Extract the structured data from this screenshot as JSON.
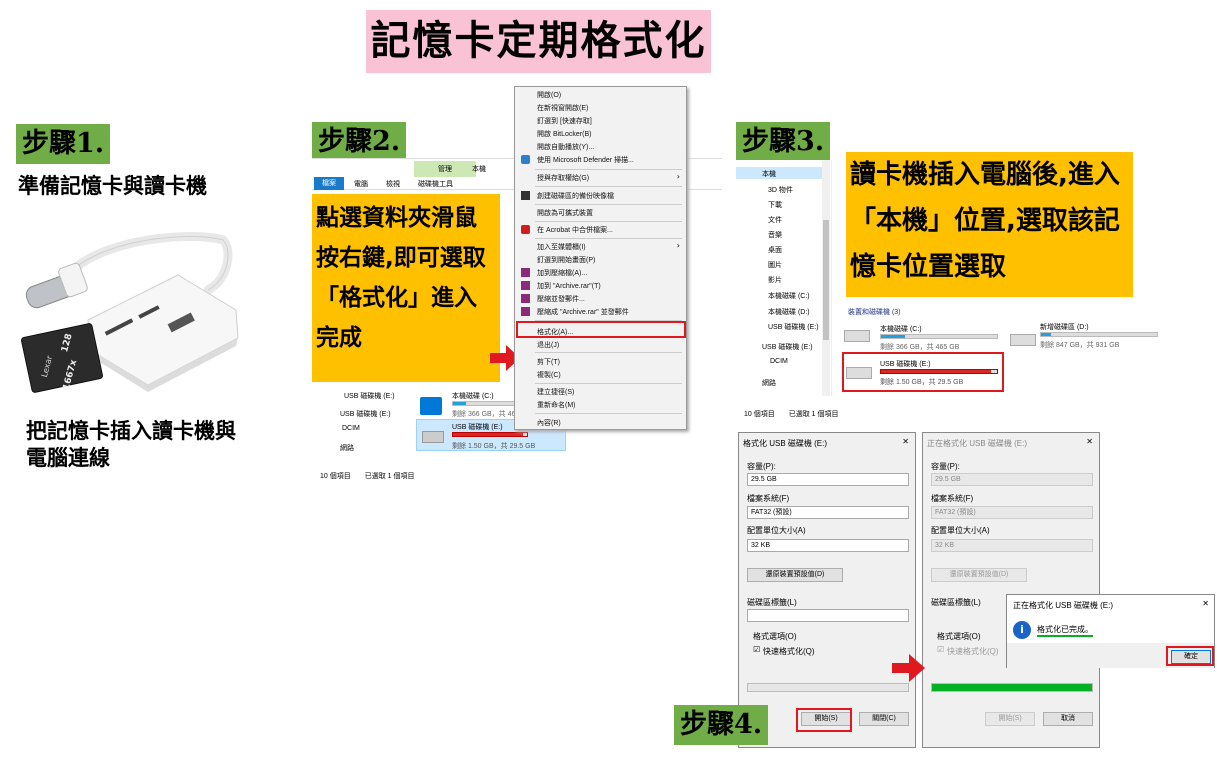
{
  "title": "記憶卡定期格式化",
  "steps": {
    "s1": "步驟1.",
    "s2": "步驟2.",
    "s3": "步驟3.",
    "s4": "步驟4."
  },
  "step1": {
    "heading": "準備記憶卡與讀卡機",
    "note": "把記憶卡插入讀卡機與電腦連線",
    "sd_label": "Lexar",
    "sd_cap": "128",
    "sd_speed": "1667x"
  },
  "step2": {
    "callout": "點選資料夾滑鼠按右鍵,即可選取「格式化」進入完成",
    "ribbon_tabs": [
      "檔案",
      "電腦",
      "檢視",
      "磁碟機工具"
    ],
    "ribbon_group": "管理",
    "ribbon_title": "本機",
    "nav": [
      "USB 磁碟機 (E:)",
      "USB 磁碟機 (E:)",
      "DCIM",
      "網路"
    ],
    "drive_c": "本機磁碟 (C:)",
    "drive_c_space": "剩餘 366 GB，共 46",
    "drive_e": "USB 磁碟機 (E:)",
    "drive_e_space": "剩餘 1.50 GB，共 29.5 GB",
    "status": "10 個項目　　已選取 1 個項目",
    "menu": [
      "開啟(O)",
      "在新視窗開啟(E)",
      "釘選到 [快速存取]",
      "開啟 BitLocker(B)",
      "開啟自動播放(Y)...",
      "使用 Microsoft Defender 掃描...",
      "授與存取權給(G)",
      "創建磁碟區的備份映像檔",
      "開啟為可攜式裝置",
      "在 Acrobat 中合併檔案...",
      "加入至媒體櫃(I)",
      "釘選到開始畫面(P)",
      "加到壓縮檔(A)...",
      "加到 \"Archive.rar\"(T)",
      "壓縮並發郵件...",
      "壓縮成 \"Archive.rar\" 並發郵件",
      "格式化(A)...",
      "退出(J)",
      "剪下(T)",
      "複製(C)",
      "建立捷徑(S)",
      "重新命名(M)",
      "內容(R)"
    ]
  },
  "step3": {
    "callout": "讀卡機插入電腦後,進入「本機」位置,選取該記憶卡位置選取",
    "nav": [
      "本機",
      "3D 物件",
      "下載",
      "文件",
      "音樂",
      "桌面",
      "圖片",
      "影片",
      "本機磁碟 (C:)",
      "本機磁碟 (D:)",
      "USB 磁碟機 (E:)",
      "USB 磁碟機 (E:)",
      "DCIM",
      "網路"
    ],
    "section": "裝置和磁碟機 (3)",
    "drive_c": "本機磁碟 (C:)",
    "drive_c_space": "剩餘 366 GB，共 465 GB",
    "drive_d": "新增磁碟區 (D:)",
    "drive_d_space": "剩餘 847 GB，共 931 GB",
    "drive_e": "USB 磁碟機 (E:)",
    "drive_e_space": "剩餘 1.50 GB，共 29.5 GB",
    "status": "10 個項目　　已選取 1 個項目",
    "usage": {
      "c": 0.21,
      "d": 0.09,
      "e": 0.95
    }
  },
  "step4": {
    "dlg1_title": "格式化 USB 磁碟機 (E:)",
    "dlg2_title": "正在格式化 USB 磁碟機 (E:)",
    "capacity_label": "容量(P):",
    "capacity": "29.5 GB",
    "fs_label": "檔案系統(F)",
    "fs": "FAT32 (預設)",
    "alloc_label": "配置單位大小(A)",
    "alloc": "32 KB",
    "restore_btn": "還原裝置預設值(D)",
    "volume_label": "磁碟區標籤(L)",
    "options_label": "格式選項(O)",
    "quick": "快速格式化(Q)",
    "start": "開始(S)",
    "close": "關閉(C)",
    "cancel": "取消",
    "progress": 1.0,
    "msg_title": "正在格式化 USB 磁碟機 (E:)",
    "msg_text": "格式化已完成。",
    "ok": "確定",
    "close_x": "✕"
  },
  "colors": {
    "title_bg": "#f9c2d5",
    "step_bg": "#70ad47",
    "callout_bg": "#ffc000",
    "highlight": "#e0181f",
    "drive_bar": "#26a0da",
    "progress": "#06b025"
  }
}
